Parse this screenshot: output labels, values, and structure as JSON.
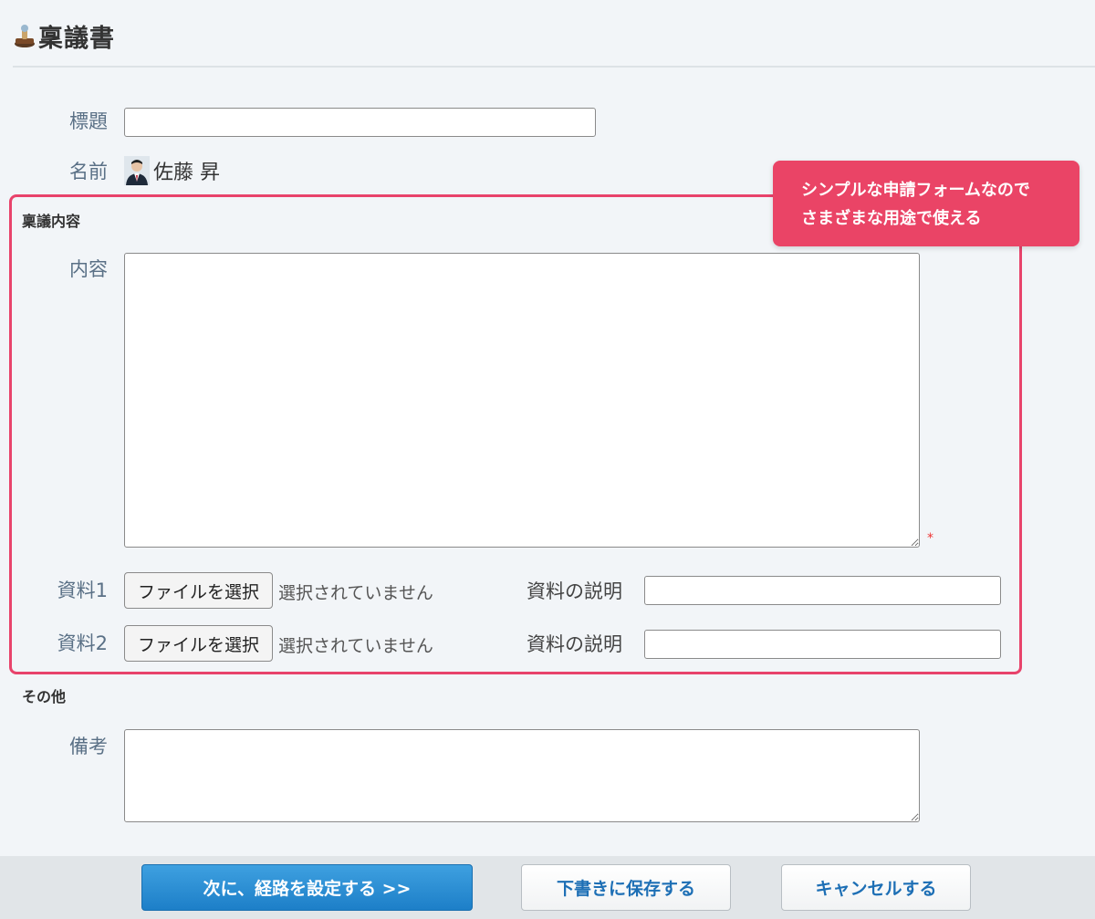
{
  "header": {
    "title": "稟議書",
    "icon": "stamp-icon"
  },
  "fields": {
    "subject_label": "標題",
    "subject_value": "",
    "name_label": "名前",
    "name_value": "佐藤 昇"
  },
  "section_main": {
    "title": "稟議内容",
    "content_label": "内容",
    "content_value": "",
    "required_mark": "*",
    "attachments": [
      {
        "label": "資料1",
        "button": "ファイルを選択",
        "status": "選択されていません",
        "desc_label": "資料の説明",
        "desc_value": ""
      },
      {
        "label": "資料2",
        "button": "ファイルを選択",
        "status": "選択されていません",
        "desc_label": "資料の説明",
        "desc_value": ""
      }
    ]
  },
  "section_other": {
    "title": "その他",
    "remarks_label": "備考",
    "remarks_value": ""
  },
  "callout": {
    "line1": "シンプルな申請フォームなので",
    "line2": "さまざまな用途で使える"
  },
  "footer": {
    "next_label": "次に、経路を設定する >>",
    "draft_label": "下書きに保存する",
    "cancel_label": "キャンセルする"
  },
  "colors": {
    "accent": "#e8436b",
    "primary_button": "#2a8fd6",
    "label": "#5a7086",
    "background": "#f2f5f8"
  }
}
